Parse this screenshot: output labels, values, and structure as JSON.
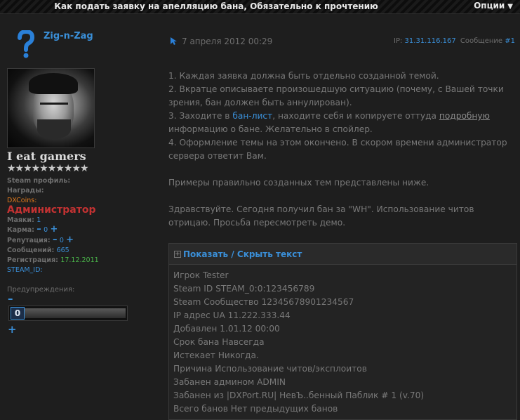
{
  "thread": {
    "title": "Как подать заявку на апелляцию бана, Обязательно к прочтению",
    "options_label": "Опции",
    "options_caret": "▼"
  },
  "user": {
    "name": "Zig-n-Zag",
    "title": "I eat gamers",
    "stars": "★★★★★★★★★★",
    "steam_profile_label": "Steam профиль:",
    "awards_label": "Награды:",
    "dxcoins_label": "DXCoins:",
    "role": "Администратор",
    "beacons_label": "Маяки:",
    "beacons_value": "1",
    "karma_label": "Карма:",
    "karma_value": "0",
    "reputation_label": "Репутация:",
    "reputation_value": "0",
    "posts_label": "Сообщений:",
    "posts_value": "665",
    "registration_label": "Регистрация:",
    "registration_value": "17.12.2011",
    "steam_id_label": "STEAM_ID:",
    "warnings_label": "Предупреждения:",
    "warnings_value": "0",
    "minus": "–",
    "plus": "+"
  },
  "post": {
    "date": "7 апреля 2012 00:29",
    "ip_label": "IP:",
    "ip_value": "31.31.116.167",
    "message_label": "Сообщение",
    "message_number": "#1",
    "lines": {
      "l1": "1. Каждая заявка должна быть отдельно созданной темой.",
      "l2": "2. Вкратце описываете произошедшую ситуацию (почему, с Вашей точки",
      "l3": "зрения, бан должен быть аннулирован).",
      "l4a": "3. Заходите в ",
      "l4link": "бан-лист",
      "l4b": ", находите себя и копируете оттуда ",
      "l4u": "подробную",
      "l5": "информацию о бане. Желательно в спойлер.",
      "l6": "4. Оформление темы на этом окончено. В скором времени администратор",
      "l7": "сервера ответит Вам.",
      "l8": "Примеры правильно созданных тем представлены ниже.",
      "l9": "Здравствуйте. Сегодня получил бан за \"WH\". Использование читов",
      "l10": "отрицаю. Просьба пересмотреть демо."
    }
  },
  "spoiler": {
    "toggle": "+",
    "title": "Показать / Скрыть текст",
    "lines": [
      "Игрок Tester",
      "Steam ID STEAM_0:0:123456789",
      "Steam Сообщество 12345678901234567",
      "IP адрес UA 11.222.333.44",
      "Добавлен 1.01.12 00:00",
      "Срок бана Навсегда",
      "Истекает Никогда.",
      "Причина Использование читов/эксплоитов",
      "Забанен админом ADMIN",
      "Забанен из |DXPort.RU| НевЪ..бенный Паблик # 1 (v.70)",
      "Всего банов Нет предыдущих банов"
    ]
  }
}
